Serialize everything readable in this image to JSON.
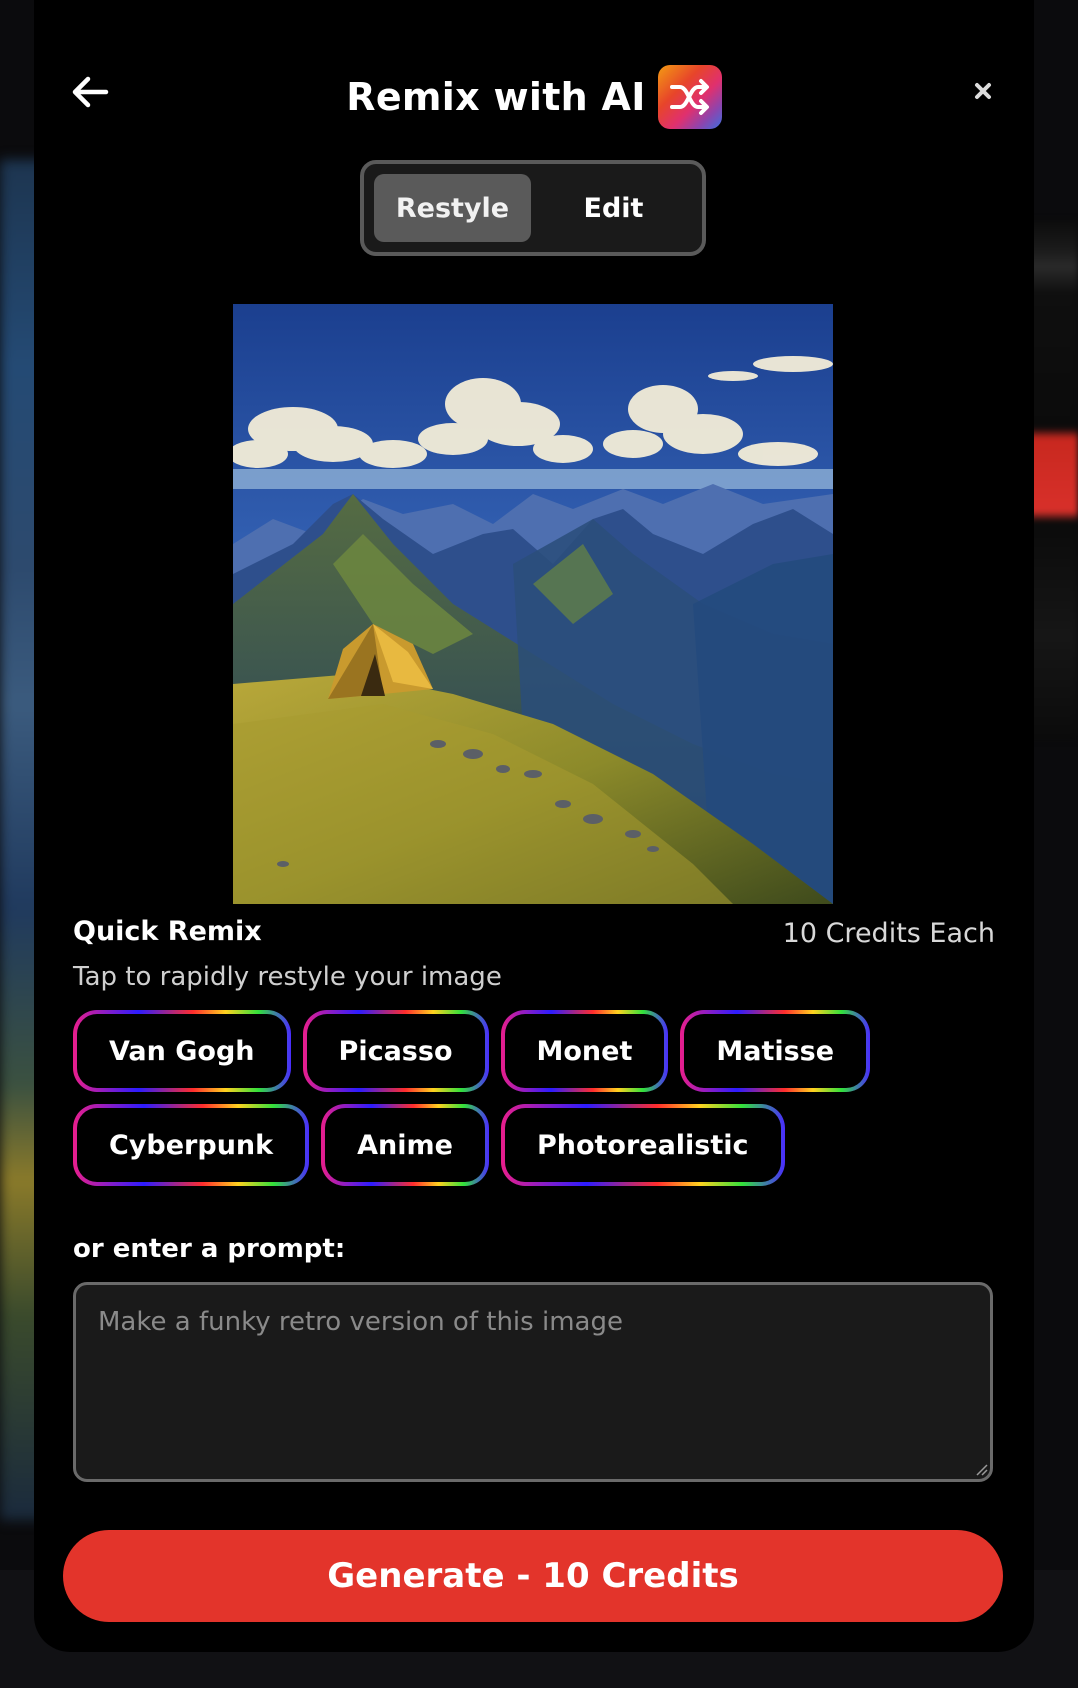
{
  "header": {
    "title": "Remix with AI",
    "back_icon": "arrow-left-icon",
    "close_icon": "close-icon",
    "title_icon": "shuffle-icon"
  },
  "tabs": [
    {
      "label": "Restyle",
      "active": true
    },
    {
      "label": "Edit",
      "active": false
    }
  ],
  "preview": {
    "subject": "painting of a yellow tent on a grassy mountainside with blue peaks and clouds"
  },
  "quick_remix": {
    "title": "Quick Remix",
    "credits": "10 Credits Each",
    "subtitle": "Tap to rapidly restyle your image",
    "styles_row1": [
      "Van Gogh",
      "Picasso",
      "Monet",
      "Matisse"
    ],
    "styles_row2": [
      "Cyberpunk",
      "Anime",
      "Photorealistic"
    ]
  },
  "prompt": {
    "label": "or enter a prompt:",
    "placeholder": "Make a funky retro version of this image",
    "value": ""
  },
  "generate": {
    "label": "Generate - 10 Credits"
  },
  "colors": {
    "accent": "#e3342b",
    "background": "#000000",
    "segment_active": "#5a5a5a"
  }
}
